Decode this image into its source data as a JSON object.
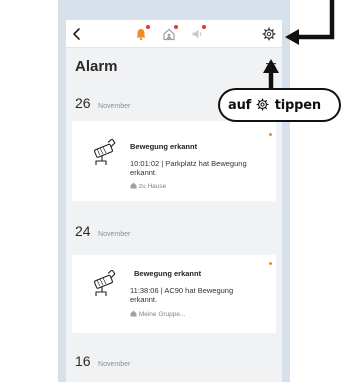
{
  "header": {
    "back_icon": "chevron-left-icon",
    "alarm_bell_icon": "bell-icon",
    "home_icon": "home-shield-icon",
    "sound_icon": "speaker-icon",
    "settings_icon": "gear-icon",
    "accent_color": "#f08a2a",
    "badge_color": "#e53935"
  },
  "page": {
    "title": "Alarm",
    "menu_icon": "hamburger-icon"
  },
  "groups": [
    {
      "day": "26",
      "month": "November",
      "card": {
        "title": "Bewegung erkannt",
        "body": "10:01:02 | Parkplatz hat Bewegung erkannt.",
        "location": "zu Hause",
        "icon": "camera-icon"
      }
    },
    {
      "day": "24",
      "month": "November",
      "card": {
        "title": "Bewegung erkannt",
        "body": "11:38:06 | AC90 hat Bewegung erkannt.",
        "location": "Meine Gruppe...",
        "icon": "camera-icon"
      }
    },
    {
      "day": "16",
      "month": "November"
    }
  ],
  "annotation": {
    "text_before": "auf",
    "text_after": "tippen",
    "icon": "gear-icon"
  }
}
